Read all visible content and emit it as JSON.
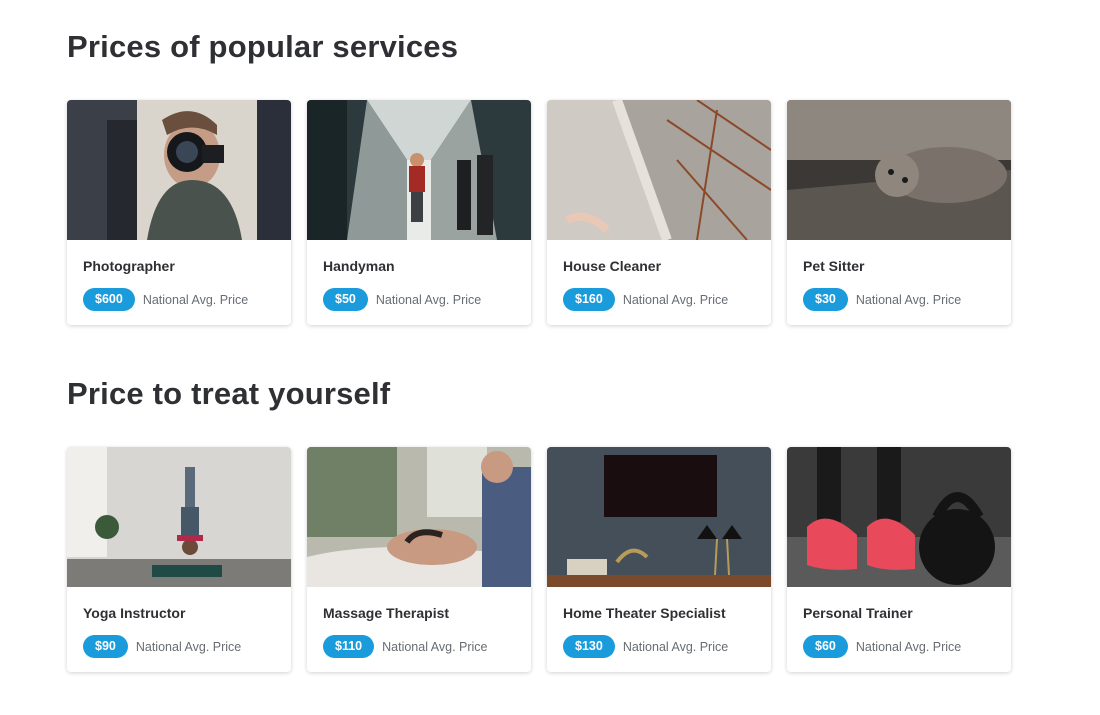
{
  "sections": [
    {
      "title": "Prices of popular services",
      "cards": [
        {
          "name": "Photographer",
          "price": "$600",
          "caption": "National Avg. Price"
        },
        {
          "name": "Handyman",
          "price": "$50",
          "caption": "National Avg. Price"
        },
        {
          "name": "House Cleaner",
          "price": "$160",
          "caption": "National Avg. Price"
        },
        {
          "name": "Pet Sitter",
          "price": "$30",
          "caption": "National Avg. Price"
        }
      ]
    },
    {
      "title": "Price to treat yourself",
      "cards": [
        {
          "name": "Yoga Instructor",
          "price": "$90",
          "caption": "National Avg. Price"
        },
        {
          "name": "Massage Therapist",
          "price": "$110",
          "caption": "National Avg. Price"
        },
        {
          "name": "Home Theater Specialist",
          "price": "$130",
          "caption": "National Avg. Price"
        },
        {
          "name": "Personal Trainer",
          "price": "$60",
          "caption": "National Avg. Price"
        }
      ]
    }
  ],
  "colors": {
    "accent": "#1a9bdc",
    "title": "#2f3033",
    "caption": "#676d73"
  }
}
